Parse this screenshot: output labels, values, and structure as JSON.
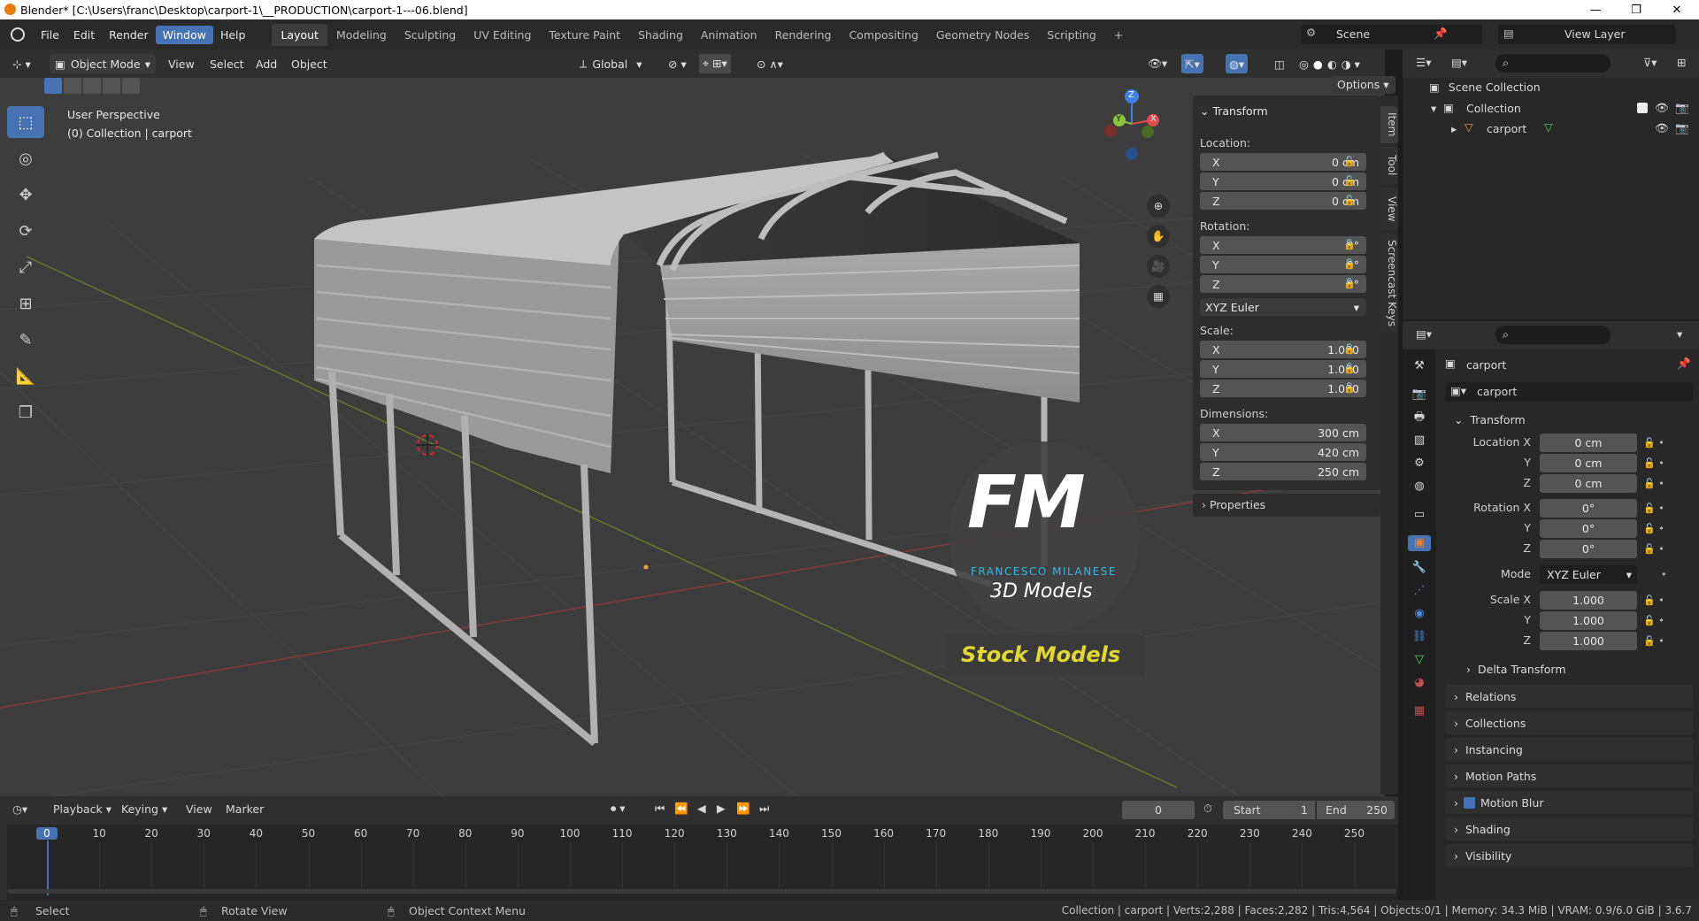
{
  "window": {
    "title": "Blender* [C:\\Users\\franc\\Desktop\\carport-1\\__PRODUCTION\\carport-1---06.blend]",
    "minimize": "—",
    "maximize": "❐",
    "close": "✕"
  },
  "menus": [
    "File",
    "Edit",
    "Render",
    "Window",
    "Help"
  ],
  "active_menu": "Window",
  "workspaces": [
    "Layout",
    "Modeling",
    "Sculpting",
    "UV Editing",
    "Texture Paint",
    "Shading",
    "Animation",
    "Rendering",
    "Compositing",
    "Geometry Nodes",
    "Scripting",
    "+"
  ],
  "active_workspace": "Layout",
  "scene": {
    "label": "Scene",
    "view_layer": "View Layer"
  },
  "header3d": {
    "mode": "Object Mode",
    "view": "View",
    "select": "Select",
    "add": "Add",
    "object": "Object",
    "orientation": "Global",
    "options": "Options"
  },
  "viewport": {
    "perspective": "User Perspective",
    "collection_line": "(0) Collection | carport",
    "gizmo": {
      "z": "Z",
      "y": "Y",
      "x": "X"
    },
    "watermark": {
      "letters": "FM",
      "name": "FRANCESCO MILANESE",
      "sub": "3D Models",
      "banner": "Stock Models"
    }
  },
  "npanel": {
    "header": "Transform",
    "location_label": "Location:",
    "location": [
      {
        "axis": "X",
        "value": "0 cm"
      },
      {
        "axis": "Y",
        "value": "0 cm"
      },
      {
        "axis": "Z",
        "value": "0 cm"
      }
    ],
    "rotation_label": "Rotation:",
    "rotation": [
      {
        "axis": "X",
        "value": "0°"
      },
      {
        "axis": "Y",
        "value": "0°"
      },
      {
        "axis": "Z",
        "value": "0°"
      }
    ],
    "rotation_mode": "XYZ Euler",
    "scale_label": "Scale:",
    "scale": [
      {
        "axis": "X",
        "value": "1.000"
      },
      {
        "axis": "Y",
        "value": "1.000"
      },
      {
        "axis": "Z",
        "value": "1.000"
      }
    ],
    "dimensions_label": "Dimensions:",
    "dimensions": [
      {
        "axis": "X",
        "value": "300 cm"
      },
      {
        "axis": "Y",
        "value": "420 cm"
      },
      {
        "axis": "Z",
        "value": "250 cm"
      }
    ],
    "properties": "Properties",
    "tabs": [
      "Item",
      "Tool",
      "View",
      "Screencast Keys"
    ]
  },
  "outliner": {
    "scene_collection": "Scene Collection",
    "collection": "Collection",
    "object": "carport"
  },
  "properties": {
    "object_name": "carport",
    "datablock": "carport",
    "transform": "Transform",
    "location_x_label": "Location X",
    "y_label": "Y",
    "z_label": "Z",
    "location": [
      "0 cm",
      "0 cm",
      "0 cm"
    ],
    "rotation_x_label": "Rotation X",
    "rotation": [
      "0°",
      "0°",
      "0°"
    ],
    "mode_label": "Mode",
    "mode": "XYZ Euler",
    "scale_x_label": "Scale X",
    "scale": [
      "1.000",
      "1.000",
      "1.000"
    ],
    "delta": "Delta Transform",
    "sections": [
      "Relations",
      "Collections",
      "Instancing",
      "Motion Paths",
      "Motion Blur",
      "Shading",
      "Visibility"
    ]
  },
  "timeline": {
    "menus": [
      "Playback",
      "Keying",
      "View",
      "Marker"
    ],
    "current_frame": "0",
    "start_label": "Start",
    "start": "1",
    "end_label": "End",
    "end": "250",
    "ticks": [
      "0",
      "10",
      "20",
      "30",
      "40",
      "50",
      "60",
      "70",
      "80",
      "90",
      "100",
      "110",
      "120",
      "130",
      "140",
      "150",
      "160",
      "170",
      "180",
      "190",
      "200",
      "210",
      "220",
      "230",
      "240",
      "250"
    ]
  },
  "status": {
    "select": "Select",
    "rotate": "Rotate View",
    "context": "Object Context Menu",
    "stats": "Collection | carport | Verts:2,288 | Faces:2,282 | Tris:4,564 | Objects:0/1 | Memory: 34.3 MiB | VRAM: 0.9/6.0 GiB | 3.6.7"
  }
}
